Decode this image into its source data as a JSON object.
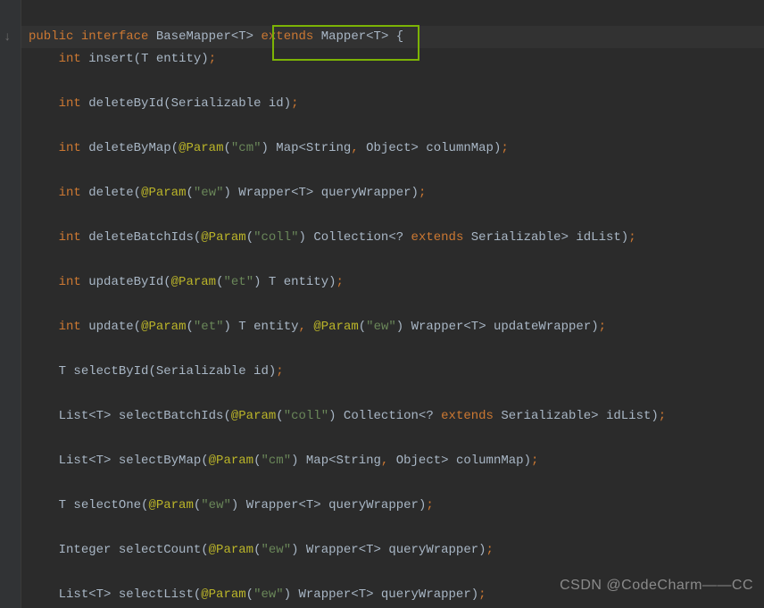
{
  "code": {
    "kw_public": "public",
    "kw_interface": "interface",
    "kw_extends": "extends",
    "kw_int": "int",
    "classname_BaseMapper": "BaseMapper",
    "classname_Mapper": "Mapper",
    "generic_T": "<T>",
    "brace_open": "{",
    "method_insert": "insert",
    "param_T_entity": "T entity",
    "method_deleteById": "deleteById",
    "param_Serializable_id": "Serializable id",
    "method_deleteByMap": "deleteByMap",
    "at_param": "@Param",
    "str_cm": "\"cm\"",
    "param_Map_columnMap": " Map<String",
    "param_Object_columnMap": " Object> columnMap",
    "method_delete": "delete",
    "str_ew": "\"ew\"",
    "param_Wrapper_queryWrapper": " Wrapper<T> queryWrapper",
    "method_deleteBatchIds": "deleteBatchIds",
    "str_coll": "\"coll\"",
    "param_Collection_wildcard": " Collection<? ",
    "param_Serializable_idList": " Serializable> idList",
    "method_updateById": "updateById",
    "str_et": "\"et\"",
    "param_T_entity2": " T entity",
    "method_update": "update",
    "param_T_entity3": " T entity",
    "param_Wrapper_updateWrapper": " Wrapper<T> updateWrapper",
    "type_T": "T ",
    "method_selectById": "selectById",
    "type_ListT": "List<T> ",
    "method_selectBatchIds": "selectBatchIds",
    "method_selectByMap": "selectByMap",
    "method_selectOne": "selectOne",
    "type_Integer": "Integer ",
    "method_selectCount": "selectCount",
    "method_selectList": "selectList"
  },
  "gutter_arrow": "↓",
  "watermark": "CSDN @CodeCharm——CC"
}
